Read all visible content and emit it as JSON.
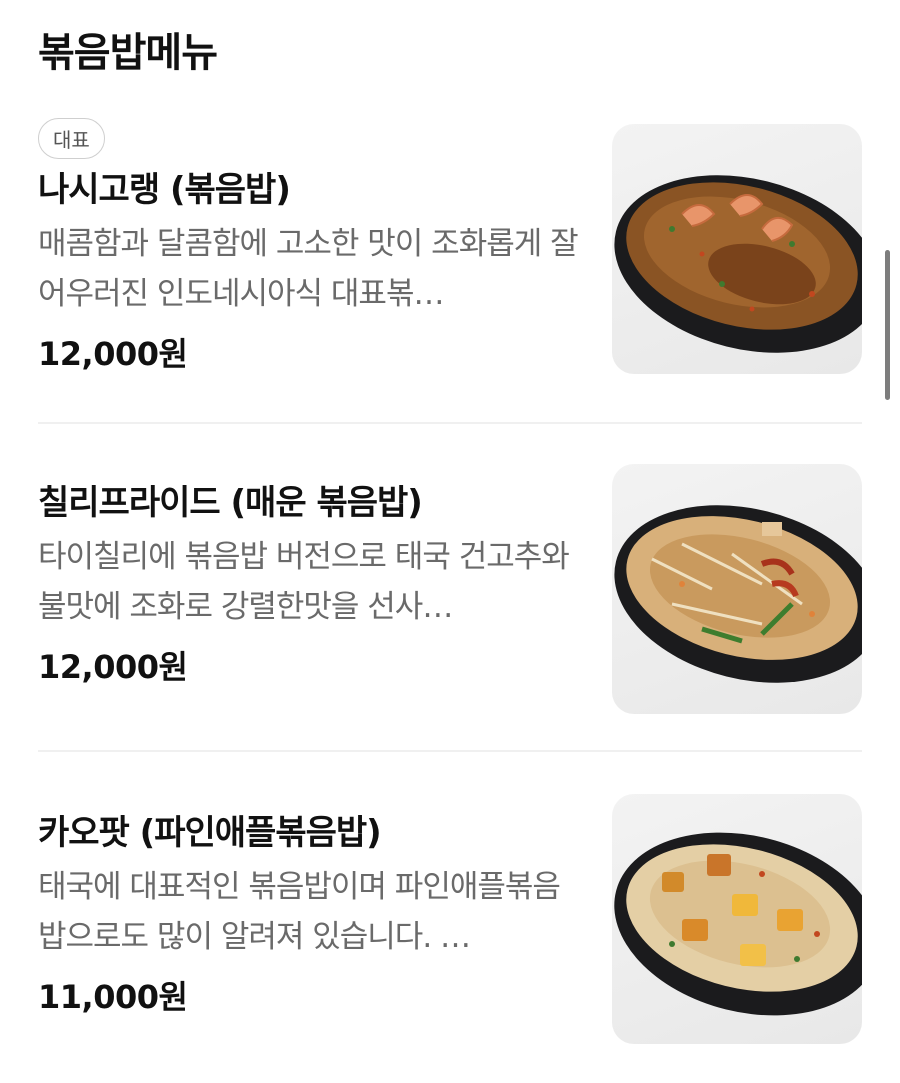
{
  "section": {
    "title": "볶음밥메뉴"
  },
  "items": [
    {
      "badge": "대표",
      "name": "나시고랭 (볶음밥)",
      "description": "매콤함과 달콤함에 고소한 맛이 조화롭게 잘 어우러진 인도네시아식 대표볶…",
      "price": "12,000원",
      "image": "nasi-goreng-photo"
    },
    {
      "name": "칠리프라이드 (매운 볶음밥)",
      "description": "타이칠리에 볶음밥 버전으로 태국 건고추와 불맛에 조화로 강렬한맛을 선사…",
      "price": "12,000원",
      "image": "chili-fried-rice-photo"
    },
    {
      "name": "카오팟 (파인애플볶음밥)",
      "description": "태국에 대표적인 볶음밥이며 파인애플볶음밥으로도 많이 알려져 있습니다. …",
      "price": "11,000원",
      "image": "khao-pad-photo"
    }
  ],
  "colors": {
    "text": "#111111",
    "muted": "#6a6a6a",
    "divider": "#f0f0f0",
    "plate": "#1b1b1d"
  }
}
